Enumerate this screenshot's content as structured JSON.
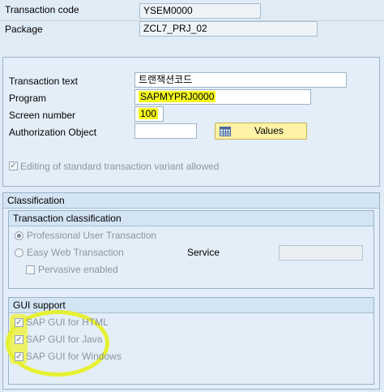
{
  "header": {
    "transaction_code_label": "Transaction code",
    "transaction_code_value": "YSEM0000",
    "package_label": "Package",
    "package_value": "ZCL7_PRJ_02"
  },
  "form": {
    "transaction_text_label": "Transaction text",
    "transaction_text_value": "트랜잭션코드",
    "program_label": "Program",
    "program_value": "SAPMYPRJ0000",
    "screen_number_label": "Screen number",
    "screen_number_value": "100",
    "authorization_object_label": "Authorization Object",
    "authorization_object_value": "",
    "values_button_label": "Values",
    "editing_variant_label": "Editing of standard transaction variant allowed",
    "editing_variant_checked": true
  },
  "classification": {
    "title": "Classification",
    "transaction_classification": {
      "title": "Transaction classification",
      "professional_label": "Professional User Transaction",
      "easy_web_label": "Easy Web Transaction",
      "service_label": "Service",
      "service_value": "",
      "pervasive_label": "Pervasive enabled"
    },
    "gui_support": {
      "title": "GUI support",
      "html_label": "SAP GUI for HTML",
      "java_label": "SAP GUI for Java",
      "windows_label": "SAP GUI for Windows"
    }
  },
  "colors": {
    "highlight": "#f4f81e",
    "background": "#dfebf5",
    "button": "#fdf2a5"
  },
  "icons": {
    "values_button_icon": "grid-icon",
    "check_mark": "✓"
  }
}
